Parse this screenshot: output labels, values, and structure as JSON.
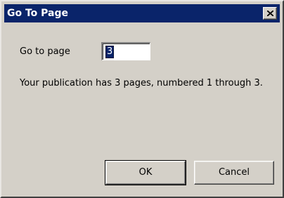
{
  "dialog": {
    "title": "Go To Page",
    "close_icon": "close-x-icon",
    "label": "Go to page",
    "input_value": "3",
    "message": "Your publication has 3 pages, numbered 1 through 3.",
    "ok_label": "OK",
    "cancel_label": "Cancel"
  },
  "colors": {
    "titlebar": "#0a246a",
    "face": "#d4d0c8",
    "selection": "#0a246a"
  }
}
